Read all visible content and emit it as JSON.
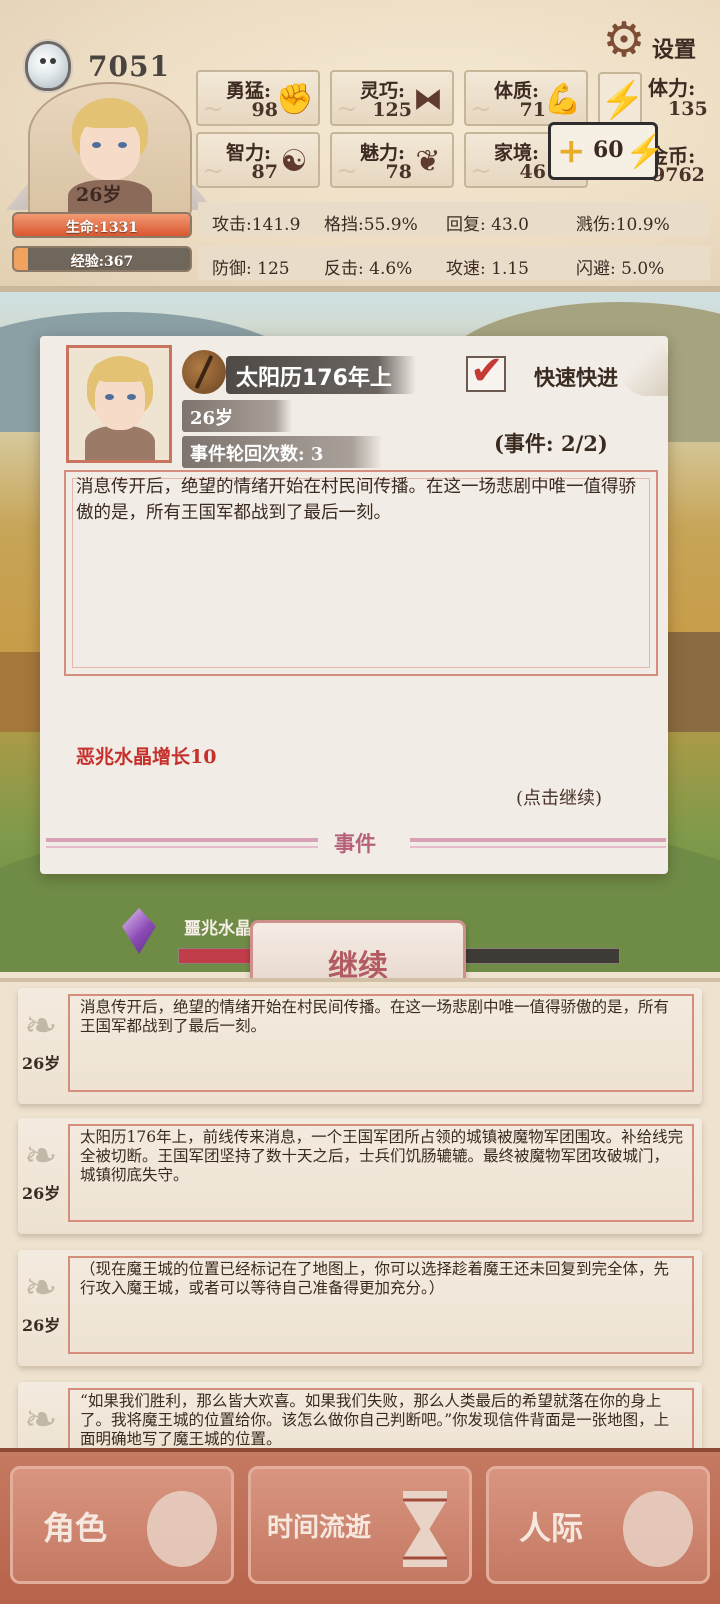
{
  "header": {
    "gems": "7051",
    "age": "26岁",
    "hp_label": "生命:1331",
    "hp_ratio": 1.0,
    "xp_label": "经验:367",
    "xp_ratio": 0.08,
    "settings_label": "设置",
    "stats": [
      {
        "label": "勇猛:",
        "value": "98",
        "icon": "fist-icon"
      },
      {
        "label": "灵巧:",
        "value": "125",
        "icon": "tie-icon"
      },
      {
        "label": "体质:",
        "value": "71",
        "icon": "arm-icon"
      },
      {
        "label": "智力:",
        "value": "87",
        "icon": "brain-icon"
      },
      {
        "label": "魅力:",
        "value": "78",
        "icon": "flower-icon"
      },
      {
        "label": "家境:",
        "value": "46",
        "icon": "house-icon"
      }
    ],
    "stamina_label": "体力:",
    "stamina_value": "135",
    "gold_label": "金币:",
    "gold_value": "9762",
    "stamina_popup": "60",
    "combat": [
      {
        "text": "攻击:141.9"
      },
      {
        "text": "格挡:55.9%"
      },
      {
        "text": "回复:  43.0"
      },
      {
        "text": "溅伤:10.9%"
      },
      {
        "text": "防御:  125"
      },
      {
        "text": "反击: 4.6%"
      },
      {
        "text": "攻速:  1.15"
      },
      {
        "text": "闪避: 5.0%"
      }
    ]
  },
  "event": {
    "date": "太阳历176年上",
    "fast_forward": "快速快进",
    "fast_forward_checked": true,
    "age": "26岁",
    "cycles": "事件轮回次数: 3",
    "counter": "(事件: 2/2)",
    "text": "消息传开后，绝望的情绪开始在村民间传播。在这一场悲剧中唯一值得骄傲的是，所有王国军都战到了最后一刻。",
    "reward": "恶兆水晶增长10",
    "click_hint": "(点击继续)",
    "section_label": "事件"
  },
  "crystal": {
    "label": "噩兆水晶",
    "fill_ratio": 0.18
  },
  "continue_label": "继续",
  "log": [
    {
      "age": "26岁",
      "text": "消息传开后，绝望的情绪开始在村民间传播。在这一场悲剧中唯一值得骄傲的是，所有王国军都战到了最后一刻。"
    },
    {
      "age": "26岁",
      "text": "太阳历176年上，前线传来消息，一个王国军团所占领的城镇被魔物军团围攻。补给线完全被切断。王国军团坚持了数十天之后，士兵们饥肠辘辘。最终被魔物军团攻破城门，城镇彻底失守。"
    },
    {
      "age": "26岁",
      "text": "（现在魔王城的位置已经标记在了地图上，你可以选择趁着魔王还未回复到完全体，先行攻入魔王城，或者可以等待自己准备得更加充分。）"
    },
    {
      "age": "26岁",
      "text": "“如果我们胜利，那么皆大欢喜。如果我们失败，那么人类最后的希望就落在你的身上了。我将魔王城的位置给你。该怎么做你自己判断吧。”你发现信件背面是一张地图，上面明确地写了魔王城的位置。"
    }
  ],
  "nav": [
    {
      "label": "角色"
    },
    {
      "label": "时间流逝"
    },
    {
      "label": "人际"
    }
  ]
}
